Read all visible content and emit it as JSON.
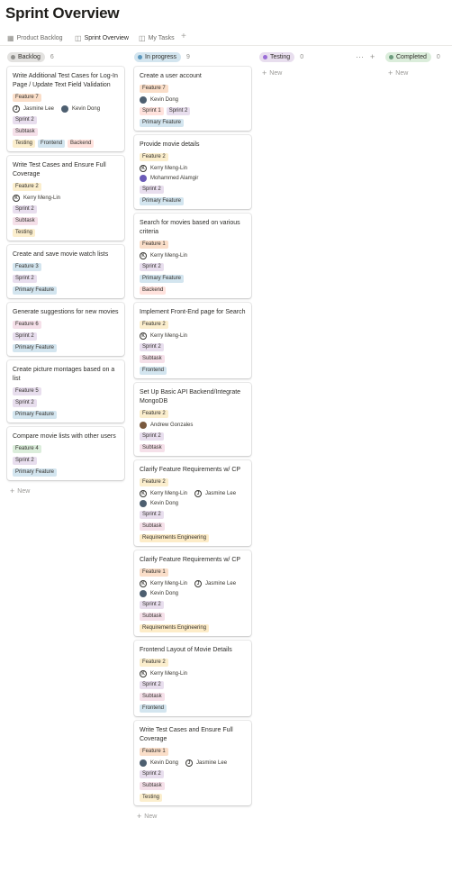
{
  "page": {
    "title": "Sprint Overview"
  },
  "tabs": [
    {
      "label": "Product Backlog",
      "icon": "table-icon",
      "active": false
    },
    {
      "label": "Sprint Overview",
      "icon": "board-icon",
      "active": true
    },
    {
      "label": "My Tasks",
      "icon": "board-icon",
      "active": false
    }
  ],
  "tab_add": "+",
  "new_label": "New",
  "colors": {
    "feature1": "#fadec9",
    "feature2": "#fbeecd",
    "feature3": "#d3e5ef",
    "feature4": "#dbeddb",
    "feature5": "#e8deee",
    "feature6": "#f5e0e9",
    "feature7": "#fadec9",
    "sprint1": "#ffe2dd",
    "sprint2": "#e8deee",
    "subtask": "#f5e0e9",
    "testing": "#fbeecd",
    "frontend": "#d3e5ef",
    "backend": "#ffe2dd",
    "primary": "#d3e5ef",
    "requirements": "#fdecc8"
  },
  "columns": [
    {
      "name": "Backlog",
      "count": "6",
      "pill_bg": "#e3e2e0",
      "dot": "#91918e",
      "cards": [
        {
          "title": "Write Additional Test Cases for Log-In Page / Update Text Field Validation",
          "feature": "Feature 7",
          "feature_color": "feature7",
          "people": [
            {
              "name": "Jasmine Lee",
              "avatar": "letter",
              "initial": "J"
            },
            {
              "name": "Kevin Dong",
              "avatar": "photo",
              "tone": "p-slate"
            }
          ],
          "sprints": [
            {
              "label": "Sprint 2",
              "color": "sprint2"
            }
          ],
          "tags": [
            [
              {
                "label": "Subtask",
                "color": "subtask"
              }
            ],
            [
              {
                "label": "Testing",
                "color": "testing"
              },
              {
                "label": "Frontend",
                "color": "frontend"
              },
              {
                "label": "Backend",
                "color": "backend"
              }
            ]
          ]
        },
        {
          "title": "Write Test Cases and Ensure Full Coverage",
          "feature": "Feature 2",
          "feature_color": "feature2",
          "people": [
            {
              "name": "Kerry Meng-Lin",
              "avatar": "letter",
              "initial": "K"
            }
          ],
          "sprints": [
            {
              "label": "Sprint 2",
              "color": "sprint2"
            }
          ],
          "tags": [
            [
              {
                "label": "Subtask",
                "color": "subtask"
              }
            ],
            [
              {
                "label": "Testing",
                "color": "testing"
              }
            ]
          ]
        },
        {
          "title": "Create and save movie watch lists",
          "feature": "Feature 3",
          "feature_color": "feature3",
          "people": [],
          "sprints": [
            {
              "label": "Sprint 2",
              "color": "sprint2"
            }
          ],
          "tags": [
            [
              {
                "label": "Primary Feature",
                "color": "primary"
              }
            ]
          ]
        },
        {
          "title": "Generate suggestions for new movies",
          "feature": "Feature 6",
          "feature_color": "feature6",
          "people": [],
          "sprints": [
            {
              "label": "Sprint 2",
              "color": "sprint2"
            }
          ],
          "tags": [
            [
              {
                "label": "Primary Feature",
                "color": "primary"
              }
            ]
          ]
        },
        {
          "title": "Create picture montages based on a list",
          "feature": "Feature 5",
          "feature_color": "feature5",
          "people": [],
          "sprints": [
            {
              "label": "Sprint 2",
              "color": "sprint2"
            }
          ],
          "tags": [
            [
              {
                "label": "Primary Feature",
                "color": "primary"
              }
            ]
          ]
        },
        {
          "title": "Compare movie lists with other users",
          "feature": "Feature 4",
          "feature_color": "feature4",
          "people": [],
          "sprints": [
            {
              "label": "Sprint 2",
              "color": "sprint2"
            }
          ],
          "tags": [
            [
              {
                "label": "Primary Feature",
                "color": "primary"
              }
            ]
          ]
        }
      ]
    },
    {
      "name": "In progress",
      "count": "9",
      "pill_bg": "#d3e5ef",
      "dot": "#5b97bd",
      "cards": [
        {
          "title": "Create a user account",
          "feature": "Feature 7",
          "feature_color": "feature7",
          "people": [
            {
              "name": "Kevin Dong",
              "avatar": "photo",
              "tone": "p-slate"
            }
          ],
          "sprints": [
            {
              "label": "Sprint 1",
              "color": "sprint1"
            },
            {
              "label": "Sprint 2",
              "color": "sprint2"
            }
          ],
          "tags": [
            [
              {
                "label": "Primary Feature",
                "color": "primary"
              }
            ]
          ]
        },
        {
          "title": "Provide movie details",
          "feature": "Feature 2",
          "feature_color": "feature2",
          "people": [
            {
              "name": "Kerry Meng-Lin",
              "avatar": "letter",
              "initial": "K"
            },
            {
              "name": "Mohammed Alamgir",
              "avatar": "photo",
              "tone": "p-purple"
            }
          ],
          "people_stacked": true,
          "sprints": [
            {
              "label": "Sprint 2",
              "color": "sprint2"
            }
          ],
          "tags": [
            [
              {
                "label": "Primary Feature",
                "color": "primary"
              }
            ]
          ]
        },
        {
          "title": "Search for movies based on various criteria",
          "feature": "Feature 1",
          "feature_color": "feature1",
          "people": [
            {
              "name": "Kerry Meng-Lin",
              "avatar": "letter",
              "initial": "K"
            }
          ],
          "sprints": [
            {
              "label": "Sprint 2",
              "color": "sprint2"
            }
          ],
          "tags": [
            [
              {
                "label": "Primary Feature",
                "color": "primary"
              }
            ],
            [
              {
                "label": "Backend",
                "color": "backend"
              }
            ]
          ]
        },
        {
          "title": "Implement Front-End page for Search",
          "feature": "Feature 2",
          "feature_color": "feature2",
          "people": [
            {
              "name": "Kerry Meng-Lin",
              "avatar": "letter",
              "initial": "K"
            }
          ],
          "sprints": [
            {
              "label": "Sprint 2",
              "color": "sprint2"
            }
          ],
          "tags": [
            [
              {
                "label": "Subtask",
                "color": "subtask"
              }
            ],
            [
              {
                "label": "Frontend",
                "color": "frontend"
              }
            ]
          ]
        },
        {
          "title": "Set Up Basic API Backend/Integrate MongoDB",
          "feature": "Feature 2",
          "feature_color": "feature2",
          "people": [
            {
              "name": "Andrew Gonzales",
              "avatar": "photo",
              "tone": "p-brown"
            }
          ],
          "sprints": [
            {
              "label": "Sprint 2",
              "color": "sprint2"
            }
          ],
          "tags": [
            [
              {
                "label": "Subtask",
                "color": "subtask"
              }
            ]
          ]
        },
        {
          "title": "Clarify Feature Requirements w/ CP",
          "feature": "Feature 2",
          "feature_color": "feature2",
          "people": [
            {
              "name": "Kerry Meng-Lin",
              "avatar": "letter",
              "initial": "K"
            },
            {
              "name": "Jasmine Lee",
              "avatar": "letter",
              "initial": "J"
            },
            {
              "name": "Kevin Dong",
              "avatar": "photo",
              "tone": "p-slate"
            }
          ],
          "sprints": [
            {
              "label": "Sprint 2",
              "color": "sprint2"
            }
          ],
          "tags": [
            [
              {
                "label": "Subtask",
                "color": "subtask"
              }
            ],
            [
              {
                "label": "Requirements Engineering",
                "color": "requirements"
              }
            ]
          ]
        },
        {
          "title": "Clarify Feature Requirements w/ CP",
          "feature": "Feature 1",
          "feature_color": "feature1",
          "people": [
            {
              "name": "Kerry Meng-Lin",
              "avatar": "letter",
              "initial": "K"
            },
            {
              "name": "Jasmine Lee",
              "avatar": "letter",
              "initial": "J"
            },
            {
              "name": "Kevin Dong",
              "avatar": "photo",
              "tone": "p-slate"
            }
          ],
          "sprints": [
            {
              "label": "Sprint 2",
              "color": "sprint2"
            }
          ],
          "tags": [
            [
              {
                "label": "Subtask",
                "color": "subtask"
              }
            ],
            [
              {
                "label": "Requirements Engineering",
                "color": "requirements"
              }
            ]
          ]
        },
        {
          "title": "Frontend Layout of Movie Details",
          "feature": "Feature 2",
          "feature_color": "feature2",
          "people": [
            {
              "name": "Kerry Meng-Lin",
              "avatar": "letter",
              "initial": "K"
            }
          ],
          "sprints": [
            {
              "label": "Sprint 2",
              "color": "sprint2"
            }
          ],
          "tags": [
            [
              {
                "label": "Subtask",
                "color": "subtask"
              }
            ],
            [
              {
                "label": "Frontend",
                "color": "frontend"
              }
            ]
          ]
        },
        {
          "title": "Write Test Cases and Ensure Full Coverage",
          "feature": "Feature 1",
          "feature_color": "feature1",
          "people": [
            {
              "name": "Kevin Dong",
              "avatar": "photo",
              "tone": "p-slate"
            },
            {
              "name": "Jasmine Lee",
              "avatar": "letter",
              "initial": "J"
            }
          ],
          "sprints": [
            {
              "label": "Sprint 2",
              "color": "sprint2"
            }
          ],
          "tags": [
            [
              {
                "label": "Subtask",
                "color": "subtask"
              }
            ],
            [
              {
                "label": "Testing",
                "color": "testing"
              }
            ]
          ]
        }
      ]
    },
    {
      "name": "Testing",
      "count": "0",
      "pill_bg": "#e8deee",
      "dot": "#9a6dd7",
      "actions": [
        "···",
        "+"
      ],
      "cards": []
    },
    {
      "name": "Completed",
      "count": "0",
      "pill_bg": "#dbeddb",
      "dot": "#6c9b7d",
      "cards": []
    }
  ]
}
